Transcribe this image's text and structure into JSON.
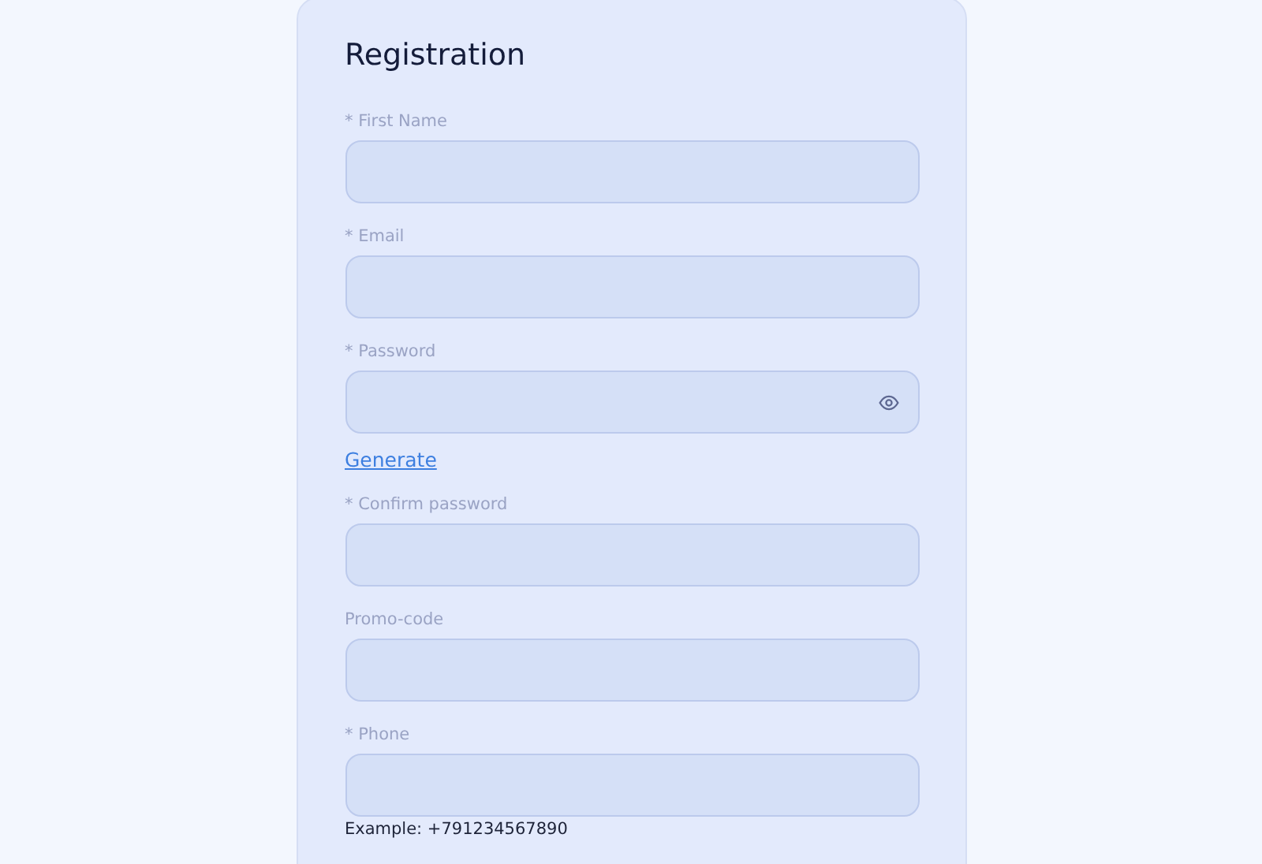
{
  "form": {
    "title": "Registration",
    "fields": [
      {
        "label": "* First Name",
        "kind": "text"
      },
      {
        "label": "* Email",
        "kind": "text"
      },
      {
        "label": "* Password",
        "kind": "password",
        "link": "Generate"
      },
      {
        "label": "* Confirm password",
        "kind": "text"
      },
      {
        "label": "Promo-code",
        "kind": "text"
      },
      {
        "label": "* Phone",
        "kind": "text",
        "hint": "Example: +791234567890"
      }
    ]
  }
}
